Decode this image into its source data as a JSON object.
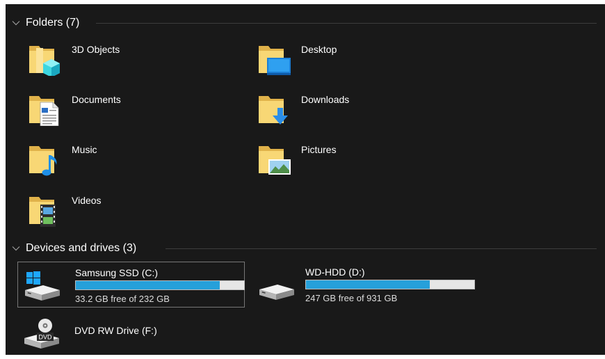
{
  "groups": {
    "folders": {
      "label": "Folders (7)"
    },
    "devices": {
      "label": "Devices and drives (3)"
    }
  },
  "folders": [
    {
      "name": "3D Objects",
      "icon": "3d-objects-folder-icon"
    },
    {
      "name": "Desktop",
      "icon": "desktop-folder-icon"
    },
    {
      "name": "Documents",
      "icon": "documents-folder-icon"
    },
    {
      "name": "Downloads",
      "icon": "downloads-folder-icon"
    },
    {
      "name": "Music",
      "icon": "music-folder-icon"
    },
    {
      "name": "Pictures",
      "icon": "pictures-folder-icon"
    },
    {
      "name": "Videos",
      "icon": "videos-folder-icon"
    }
  ],
  "drives": [
    {
      "name": "Samsung SSD (C:)",
      "free": "33.2 GB free of 232 GB",
      "used_fraction": 0.857,
      "icon": "windows-system-drive-icon",
      "selected": true
    },
    {
      "name": "WD-HDD (D:)",
      "free": "247 GB free of 931 GB",
      "used_fraction": 0.735,
      "icon": "hard-drive-icon",
      "selected": false
    },
    {
      "name": "DVD RW Drive (F:)",
      "icon": "dvd-drive-icon",
      "icon_text": "DVD"
    }
  ],
  "colors": {
    "background": "#191919",
    "bar_fill": "#26a0da",
    "bar_empty": "#e6e6e6",
    "folder": "#f8d775",
    "folder_dark": "#e0b24a"
  }
}
